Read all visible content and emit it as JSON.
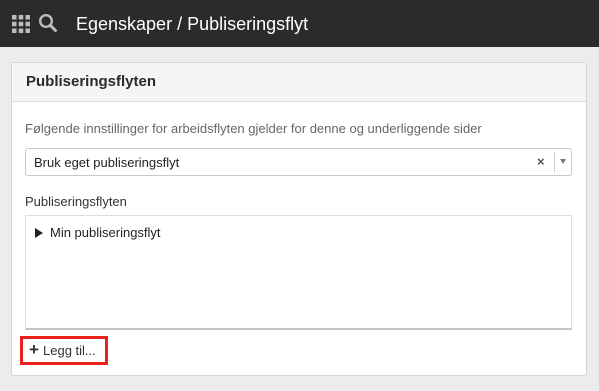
{
  "header": {
    "title": "Egenskaper / Publiseringsflyt",
    "apps_icon": "grid-icon",
    "search_icon": "search-icon"
  },
  "panel": {
    "title": "Publiseringsflyten",
    "description": "Følgende innstillinger for arbeidsflyten gjelder for denne og underliggende sider",
    "select": {
      "value": "Bruk eget publiseringsflyt",
      "clear_symbol": "×"
    },
    "list_label": "Publiseringsflyten",
    "list_items": [
      {
        "label": "Min publiseringsflyt"
      }
    ],
    "add_button": {
      "plus": "+",
      "label": "Legg til..."
    }
  },
  "colors": {
    "topbar": "#2b2b2b",
    "highlight": "#e8221b",
    "background": "#ececec"
  }
}
